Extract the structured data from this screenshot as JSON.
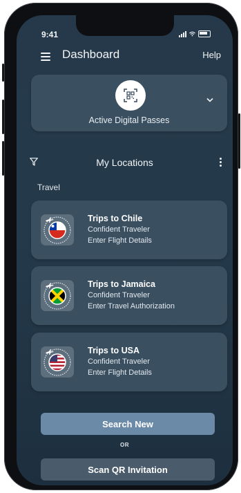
{
  "status_bar": {
    "time": "9:41"
  },
  "header": {
    "title": "Dashboard",
    "help_label": "Help"
  },
  "passes": {
    "label": "Active Digital Passes",
    "icon": "qr-code-icon"
  },
  "locations": {
    "title": "My Locations",
    "section_label": "Travel"
  },
  "trips": [
    {
      "name": "Trips to Chile",
      "subtitle": "Confident Traveler",
      "action": "Enter Flight Details",
      "flag": "chile"
    },
    {
      "name": "Trips to Jamaica",
      "subtitle": "Confident Traveler",
      "action": "Enter Travel Authorization",
      "flag": "jamaica"
    },
    {
      "name": "Trips to USA",
      "subtitle": "Confident Traveler",
      "action": "Enter Flight Details",
      "flag": "usa"
    }
  ],
  "actions": {
    "search_label": "Search New",
    "or_label": "OR",
    "scan_label": "Scan QR Invitation"
  },
  "colors": {
    "background": "#243a4b",
    "card": "#3a4f60",
    "primary_button": "#6b8aa7",
    "secondary_button": "#4a5c6b"
  }
}
